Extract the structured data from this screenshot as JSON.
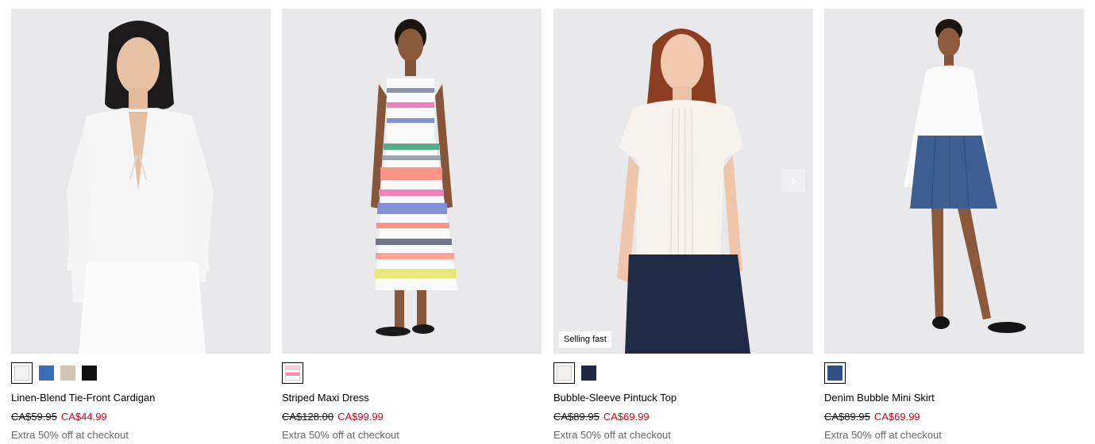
{
  "products": [
    {
      "name": "Linen-Blend Tie-Front Cardigan",
      "old_price": "CA$59.95",
      "new_price": "CA$44.99",
      "promo": "Extra 50% off at checkout",
      "swatches": [
        "#f2f2f2",
        "#3a6db8",
        "#d2c6b1",
        "#111111"
      ],
      "badge": ""
    },
    {
      "name": "Striped Maxi Dress",
      "old_price": "CA$128.00",
      "new_price": "CA$99.99",
      "promo": "Extra 50% off at checkout",
      "swatches": [
        "#f6b6c9"
      ],
      "badge": ""
    },
    {
      "name": "Bubble-Sleeve Pintuck Top",
      "old_price": "CA$89.95",
      "new_price": "CA$69.99",
      "promo": "Extra 50% off at checkout",
      "swatches": [
        "#f5f0ee",
        "#1e2746"
      ],
      "badge": "Selling fast"
    },
    {
      "name": "Denim Bubble Mini Skirt",
      "old_price": "CA$89.95",
      "new_price": "CA$69.99",
      "promo": "Extra 50% off at checkout",
      "swatches": [
        "#2f4f86"
      ],
      "badge": ""
    }
  ],
  "icons": {
    "next": "chevron-right-icon"
  },
  "colors": {
    "sale_price": "#d6001c",
    "promo_text": "#666666",
    "photo_background": "#e9e9eb"
  }
}
